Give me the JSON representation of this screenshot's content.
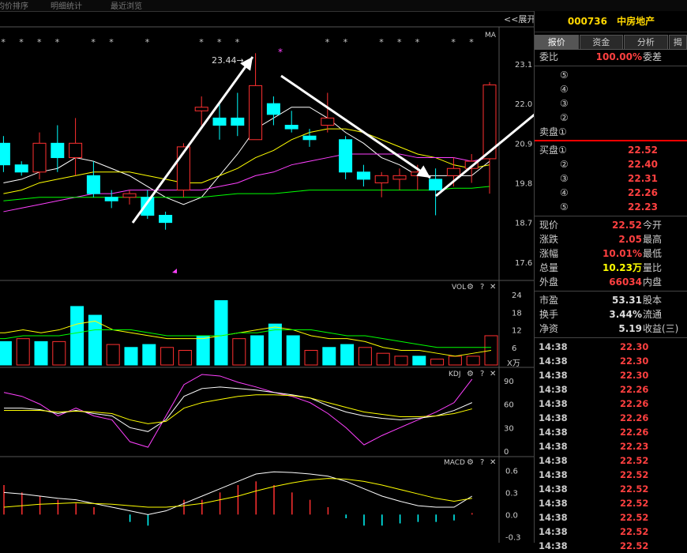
{
  "stock": {
    "code": "000736",
    "name": "中房地产"
  },
  "topbar": [
    "均价排序",
    "明细统计",
    "最近浏览"
  ],
  "expand_label": "<<展开",
  "tabs": [
    "报价",
    "资金",
    "分析",
    "揭"
  ],
  "weibi": {
    "label": "委比",
    "value": "100.00%",
    "right": "委差"
  },
  "sell_orders": [
    {
      "level": "⑤",
      "price": ""
    },
    {
      "level": "④",
      "price": ""
    },
    {
      "level": "③",
      "price": ""
    },
    {
      "level": "②",
      "price": ""
    },
    {
      "level": "卖盘①",
      "price": ""
    }
  ],
  "buy_orders": [
    {
      "level": "买盘①",
      "price": "22.52"
    },
    {
      "level": "②",
      "price": "22.40"
    },
    {
      "level": "③",
      "price": "22.31"
    },
    {
      "level": "④",
      "price": "22.26"
    },
    {
      "level": "⑤",
      "price": "22.23"
    }
  ],
  "quote": [
    {
      "label": "现价",
      "value": "22.52",
      "right": "今开",
      "color": "red"
    },
    {
      "label": "涨跌",
      "value": "2.05",
      "right": "最高",
      "color": "red"
    },
    {
      "label": "涨幅",
      "value": "10.01%",
      "right": "最低",
      "color": "red"
    },
    {
      "label": "总量",
      "value": "10.23万",
      "right": "量比",
      "color": "yel"
    },
    {
      "label": "外盘",
      "value": "66034",
      "right": "内盘",
      "color": "red"
    }
  ],
  "fundamentals": [
    {
      "label": "市盈",
      "value": "53.31",
      "right": "股本"
    },
    {
      "label": "换手",
      "value": "3.44%",
      "right": "流通"
    },
    {
      "label": "净资",
      "value": "5.19",
      "right": "收益(三)"
    }
  ],
  "trades": [
    {
      "time": "14:38",
      "price": "22.30"
    },
    {
      "time": "14:38",
      "price": "22.30"
    },
    {
      "time": "14:38",
      "price": "22.30"
    },
    {
      "time": "14:38",
      "price": "22.26"
    },
    {
      "time": "14:38",
      "price": "22.26"
    },
    {
      "time": "14:38",
      "price": "22.26"
    },
    {
      "time": "14:38",
      "price": "22.26"
    },
    {
      "time": "14:38",
      "price": "22.23"
    },
    {
      "time": "14:38",
      "price": "22.52"
    },
    {
      "time": "14:38",
      "price": "22.52"
    },
    {
      "time": "14:38",
      "price": "22.52"
    },
    {
      "time": "14:38",
      "price": "22.52"
    },
    {
      "time": "14:38",
      "price": "22.52"
    },
    {
      "time": "14:38",
      "price": "22.52"
    },
    {
      "time": "14:38",
      "price": "22.52"
    }
  ],
  "chart_data": {
    "type": "candlestick",
    "price_panel": {
      "ma_label": "MA",
      "yticks": [
        "23.1",
        "22.0",
        "20.9",
        "19.8",
        "18.7",
        "17.6"
      ],
      "ylim": [
        17.2,
        24.0
      ],
      "annotation": "23.44→",
      "candles": [
        {
          "o": 20.9,
          "h": 21.1,
          "l": 20.1,
          "c": 20.3
        },
        {
          "o": 20.3,
          "h": 20.4,
          "l": 20.0,
          "c": 20.1
        },
        {
          "o": 20.1,
          "h": 21.2,
          "l": 19.9,
          "c": 20.9
        },
        {
          "o": 20.9,
          "h": 21.4,
          "l": 20.1,
          "c": 20.5
        },
        {
          "o": 20.5,
          "h": 21.6,
          "l": 20.0,
          "c": 20.9
        },
        {
          "o": 20.0,
          "h": 20.4,
          "l": 19.4,
          "c": 19.5
        },
        {
          "o": 19.4,
          "h": 19.6,
          "l": 19.1,
          "c": 19.3
        },
        {
          "o": 19.4,
          "h": 19.6,
          "l": 19.2,
          "c": 19.5
        },
        {
          "o": 19.4,
          "h": 19.6,
          "l": 18.8,
          "c": 18.9
        },
        {
          "o": 18.9,
          "h": 19.0,
          "l": 18.5,
          "c": 18.7
        },
        {
          "o": 19.6,
          "h": 20.9,
          "l": 19.4,
          "c": 20.8
        },
        {
          "o": 21.8,
          "h": 22.2,
          "l": 21.4,
          "c": 21.9
        },
        {
          "o": 21.6,
          "h": 22.0,
          "l": 21.0,
          "c": 21.4
        },
        {
          "o": 21.6,
          "h": 22.3,
          "l": 21.1,
          "c": 21.4
        },
        {
          "o": 21.0,
          "h": 23.4,
          "l": 21.0,
          "c": 22.5
        },
        {
          "o": 22.0,
          "h": 22.2,
          "l": 21.4,
          "c": 21.7
        },
        {
          "o": 21.4,
          "h": 21.8,
          "l": 21.2,
          "c": 21.3
        },
        {
          "o": 21.1,
          "h": 21.3,
          "l": 20.8,
          "c": 21.0
        },
        {
          "o": 21.4,
          "h": 22.3,
          "l": 21.2,
          "c": 21.6
        },
        {
          "o": 21.0,
          "h": 21.1,
          "l": 19.9,
          "c": 20.1
        },
        {
          "o": 20.1,
          "h": 20.3,
          "l": 19.7,
          "c": 19.9
        },
        {
          "o": 19.8,
          "h": 20.1,
          "l": 19.4,
          "c": 20.0
        },
        {
          "o": 19.9,
          "h": 20.2,
          "l": 19.6,
          "c": 20.0
        },
        {
          "o": 20.0,
          "h": 20.3,
          "l": 19.6,
          "c": 20.1
        },
        {
          "o": 19.9,
          "h": 20.2,
          "l": 18.9,
          "c": 19.6
        },
        {
          "o": 20.0,
          "h": 20.5,
          "l": 19.7,
          "c": 20.2
        },
        {
          "o": 20.2,
          "h": 20.6,
          "l": 19.8,
          "c": 20.4
        },
        {
          "o": 20.47,
          "h": 22.6,
          "l": 19.5,
          "c": 22.52
        }
      ],
      "ma_lines": [
        {
          "name": "MA5",
          "color": "#ffffff",
          "values": [
            19.8,
            19.9,
            20.1,
            20.2,
            20.5,
            20.4,
            20.2,
            20.0,
            19.7,
            19.4,
            19.2,
            19.4,
            20.0,
            20.6,
            21.3,
            21.6,
            21.9,
            21.9,
            21.6,
            21.2,
            20.9,
            20.5,
            20.3,
            20.0,
            20.0,
            20.0,
            20.0,
            20.4
          ]
        },
        {
          "name": "MA10",
          "color": "#ffff00",
          "values": [
            19.5,
            19.6,
            19.8,
            19.9,
            20.0,
            20.1,
            20.1,
            20.1,
            20.0,
            19.9,
            19.8,
            19.8,
            20.0,
            20.2,
            20.5,
            20.7,
            21.0,
            21.2,
            21.3,
            21.3,
            21.2,
            21.0,
            20.8,
            20.6,
            20.5,
            20.3,
            20.2,
            20.3
          ]
        },
        {
          "name": "MA20",
          "color": "#ff40ff",
          "values": [
            19.0,
            19.1,
            19.2,
            19.3,
            19.4,
            19.5,
            19.5,
            19.6,
            19.6,
            19.6,
            19.6,
            19.6,
            19.7,
            19.8,
            20.0,
            20.1,
            20.3,
            20.4,
            20.5,
            20.6,
            20.6,
            20.6,
            20.6,
            20.5,
            20.5,
            20.5,
            20.4,
            20.5
          ]
        },
        {
          "name": "MA60",
          "color": "#00ff00",
          "values": [
            19.3,
            19.35,
            19.4,
            19.4,
            19.4,
            19.4,
            19.4,
            19.4,
            19.4,
            19.4,
            19.4,
            19.4,
            19.45,
            19.5,
            19.5,
            19.5,
            19.55,
            19.6,
            19.6,
            19.6,
            19.6,
            19.6,
            19.6,
            19.6,
            19.6,
            19.65,
            19.65,
            19.7
          ]
        }
      ]
    },
    "vol_panel": {
      "label": "VOL",
      "yticks": [
        "24",
        "18",
        "12",
        "6"
      ],
      "unit": "X万",
      "ylim": [
        0,
        27
      ],
      "values": [
        20,
        8,
        9,
        8,
        8,
        20,
        17,
        7,
        6,
        7,
        6,
        5,
        10,
        22,
        9,
        10,
        14,
        10,
        5,
        6,
        7,
        6,
        4,
        3,
        3,
        2,
        3,
        3,
        10
      ],
      "ma1": [
        11,
        11,
        12,
        11,
        12,
        14,
        15,
        12,
        11,
        10,
        9,
        9,
        9,
        10,
        11,
        12,
        13,
        12,
        10,
        9,
        9,
        8,
        6,
        5,
        5,
        4,
        3,
        4,
        5
      ],
      "ma2": [
        9,
        9,
        10,
        10,
        10,
        11,
        12,
        12,
        12,
        11,
        10,
        10,
        10,
        10,
        11,
        11,
        12,
        12,
        12,
        11,
        10,
        10,
        9,
        8,
        7,
        6,
        6,
        6,
        6
      ]
    },
    "kdj_panel": {
      "label": "KDJ",
      "yticks": [
        "90",
        "60",
        "30",
        "0"
      ],
      "ylim": [
        -5,
        100
      ],
      "K": [
        55,
        55,
        53,
        48,
        52,
        48,
        45,
        30,
        25,
        40,
        70,
        80,
        82,
        80,
        78,
        75,
        72,
        68,
        58,
        50,
        45,
        42,
        40,
        42,
        45,
        52,
        62
      ],
      "D": [
        52,
        52,
        52,
        50,
        51,
        50,
        48,
        40,
        35,
        38,
        55,
        62,
        66,
        70,
        72,
        72,
        71,
        68,
        62,
        56,
        50,
        47,
        44,
        44,
        45,
        48,
        54
      ],
      "J": [
        75,
        70,
        60,
        45,
        55,
        45,
        40,
        12,
        5,
        45,
        85,
        98,
        96,
        88,
        82,
        75,
        70,
        62,
        48,
        30,
        8,
        20,
        30,
        40,
        50,
        62,
        92
      ]
    },
    "macd_panel": {
      "label": "MACD",
      "yticks": [
        "0.6",
        "0.3",
        "0.0",
        "-0.3"
      ],
      "ylim": [
        -0.35,
        0.7
      ],
      "dif": [
        0.3,
        0.28,
        0.25,
        0.22,
        0.2,
        0.15,
        0.1,
        0.05,
        0.0,
        0.05,
        0.15,
        0.25,
        0.35,
        0.45,
        0.55,
        0.58,
        0.57,
        0.55,
        0.52,
        0.45,
        0.35,
        0.25,
        0.18,
        0.12,
        0.1,
        0.1,
        0.25
      ],
      "dea": [
        0.1,
        0.12,
        0.14,
        0.15,
        0.16,
        0.15,
        0.14,
        0.12,
        0.1,
        0.1,
        0.12,
        0.15,
        0.2,
        0.25,
        0.32,
        0.38,
        0.43,
        0.47,
        0.49,
        0.48,
        0.45,
        0.4,
        0.34,
        0.28,
        0.22,
        0.18,
        0.22
      ],
      "hist": [
        0.4,
        0.3,
        0.25,
        0.2,
        0.15,
        0.1,
        0.0,
        -0.1,
        -0.15,
        0.0,
        0.2,
        0.2,
        0.3,
        0.4,
        0.45,
        0.4,
        0.3,
        0.2,
        0.1,
        -0.05,
        -0.15,
        -0.15,
        -0.12,
        -0.1,
        -0.1,
        -0.08,
        0.02
      ]
    }
  }
}
